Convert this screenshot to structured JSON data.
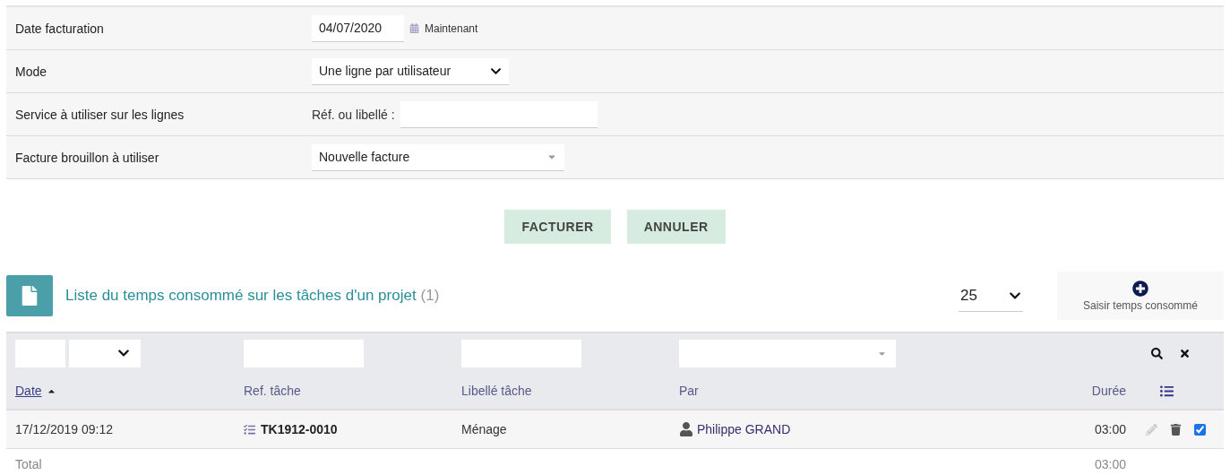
{
  "form": {
    "rows": [
      {
        "label": "Date facturation",
        "kind": "date",
        "value": "04/07/2020",
        "link": "Maintenant"
      },
      {
        "label": "Mode",
        "kind": "select",
        "value": "Une ligne par utilisateur"
      },
      {
        "label": "Service à utiliser sur les lignes",
        "kind": "search",
        "prefix": "Réf. ou libellé :"
      },
      {
        "label": "Facture brouillon à utiliser",
        "kind": "combo",
        "value": "Nouvelle facture"
      }
    ]
  },
  "buttons": [
    "FACTURER",
    "ANNULER"
  ],
  "list": {
    "title": "Liste du temps consommé sur les tâches d'un projet",
    "count": "(1)",
    "page_size": "25",
    "add_label": "Saisir temps consommé"
  },
  "table": {
    "columns": [
      {
        "label": "Date",
        "kind": "date",
        "sorted": true
      },
      {
        "label": "Ref. tâche",
        "kind": "text",
        "sorted": false
      },
      {
        "label": "Libellé tâche",
        "kind": "text",
        "sorted": false
      },
      {
        "label": "Par",
        "kind": "combo",
        "sorted": false
      },
      {
        "label": "Durée",
        "kind": "none",
        "sorted": false
      },
      {
        "kind": "actions"
      }
    ],
    "rows": [
      {
        "date": "17/12/2019 09:12",
        "ref": "TK1912-0010",
        "label": "Ménage",
        "user": "Philippe GRAND",
        "duration": "03:00",
        "selected": true
      }
    ],
    "total": {
      "label": "Total",
      "duration": "03:00"
    }
  }
}
